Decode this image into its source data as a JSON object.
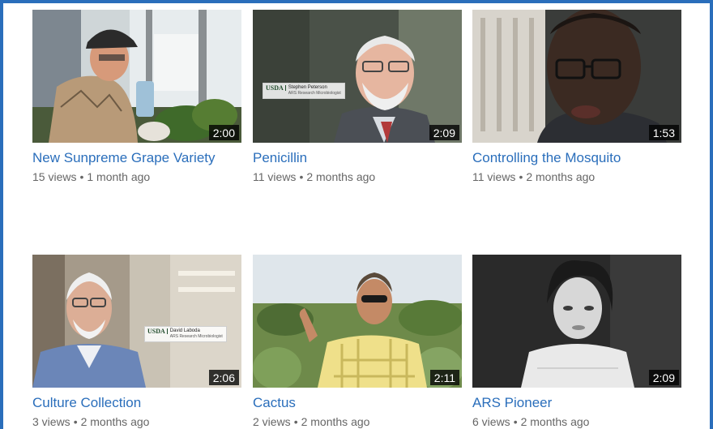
{
  "videos": [
    {
      "title": "New Sunpreme Grape Variety",
      "duration": "2:00",
      "views": "15 views",
      "age": "1 month ago",
      "separator": "•"
    },
    {
      "title": "Penicillin",
      "duration": "2:09",
      "views": "11 views",
      "age": "2 months ago",
      "separator": "•",
      "lower_third": {
        "logo": "USDA",
        "name": "Stephen Peterson",
        "role": "ARS Research Microbiologist"
      }
    },
    {
      "title": "Controlling the Mosquito",
      "duration": "1:53",
      "views": "11 views",
      "age": "2 months ago",
      "separator": "•"
    },
    {
      "title": "Culture Collection",
      "duration": "2:06",
      "views": "3 views",
      "age": "2 months ago",
      "separator": "•",
      "lower_third": {
        "logo": "USDA",
        "name": "David Laboda",
        "role": "ARS Research Microbiologist"
      }
    },
    {
      "title": "Cactus",
      "duration": "2:11",
      "views": "2 views",
      "age": "2 months ago",
      "separator": "•"
    },
    {
      "title": "ARS Pioneer",
      "duration": "2:09",
      "views": "6 views",
      "age": "2 months ago",
      "separator": "•"
    }
  ],
  "colors": {
    "frame": "#2a6ebb",
    "title_link": "#2a6ebb",
    "meta_text": "#666666"
  }
}
